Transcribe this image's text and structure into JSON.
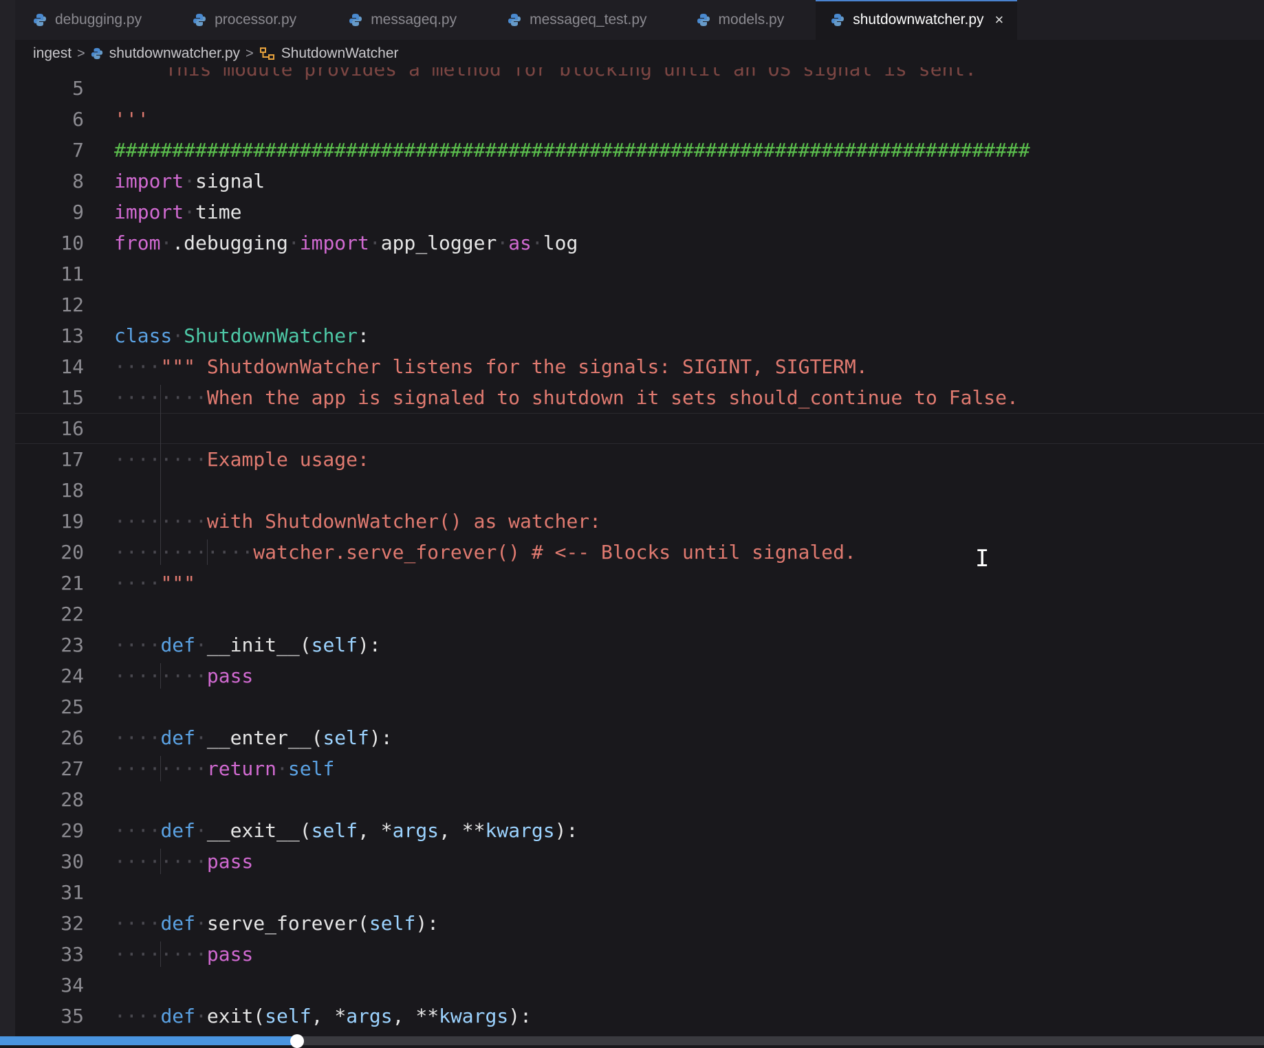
{
  "tabs": [
    {
      "label": "debugging.py",
      "active": false,
      "icon": "python-file-icon"
    },
    {
      "label": "processor.py",
      "active": false,
      "icon": "python-file-icon"
    },
    {
      "label": "messageq.py",
      "active": false,
      "icon": "python-file-icon"
    },
    {
      "label": "messageq_test.py",
      "active": false,
      "icon": "python-file-icon"
    },
    {
      "label": "models.py",
      "active": false,
      "icon": "python-file-icon"
    },
    {
      "label": "shutdownwatcher.py",
      "active": true,
      "icon": "python-file-icon"
    }
  ],
  "close_glyph": "×",
  "breadcrumb": {
    "folder": "ingest",
    "file": "shutdownwatcher.py",
    "symbol": "ShutdownWatcher",
    "separator": ">"
  },
  "editor": {
    "ghost_line": "This module provides a method for blocking until an OS signal is sent.",
    "lines": [
      {
        "n": "5",
        "tokens": []
      },
      {
        "n": "6",
        "tokens": [
          {
            "t": "str",
            "v": "'''"
          }
        ]
      },
      {
        "n": "7",
        "tokens": [
          {
            "t": "cmt",
            "v": "###############################################################################"
          }
        ]
      },
      {
        "n": "8",
        "tokens": [
          {
            "t": "kw",
            "v": "import"
          },
          {
            "t": "ws",
            "v": "·"
          },
          {
            "t": "plain",
            "v": "signal"
          }
        ]
      },
      {
        "n": "9",
        "tokens": [
          {
            "t": "kw",
            "v": "import"
          },
          {
            "t": "ws",
            "v": "·"
          },
          {
            "t": "plain",
            "v": "time"
          }
        ]
      },
      {
        "n": "10",
        "tokens": [
          {
            "t": "kw",
            "v": "from"
          },
          {
            "t": "ws",
            "v": "·"
          },
          {
            "t": "plain",
            "v": ".debugging"
          },
          {
            "t": "ws",
            "v": "·"
          },
          {
            "t": "kw",
            "v": "import"
          },
          {
            "t": "ws",
            "v": "·"
          },
          {
            "t": "plain",
            "v": "app_logger"
          },
          {
            "t": "ws",
            "v": "·"
          },
          {
            "t": "kw",
            "v": "as"
          },
          {
            "t": "ws",
            "v": "·"
          },
          {
            "t": "plain",
            "v": "log"
          }
        ]
      },
      {
        "n": "11",
        "tokens": []
      },
      {
        "n": "12",
        "tokens": []
      },
      {
        "n": "13",
        "tokens": [
          {
            "t": "kwb",
            "v": "class"
          },
          {
            "t": "ws",
            "v": "·"
          },
          {
            "t": "cls",
            "v": "ShutdownWatcher"
          },
          {
            "t": "plain",
            "v": ":"
          }
        ]
      },
      {
        "n": "14",
        "tokens": [
          {
            "t": "ws",
            "v": "····"
          },
          {
            "t": "str",
            "v": "\"\"\" ShutdownWatcher listens for the signals: SIGINT, SIGTERM."
          }
        ]
      },
      {
        "n": "15",
        "tokens": [
          {
            "t": "ws",
            "v": "········"
          },
          {
            "t": "str",
            "v": "When the app is signaled to shutdown it sets should_continue to False."
          }
        ]
      },
      {
        "n": "16",
        "tokens": [],
        "current": true
      },
      {
        "n": "17",
        "tokens": [
          {
            "t": "ws",
            "v": "········"
          },
          {
            "t": "str",
            "v": "Example usage:"
          }
        ]
      },
      {
        "n": "18",
        "tokens": []
      },
      {
        "n": "19",
        "tokens": [
          {
            "t": "ws",
            "v": "········"
          },
          {
            "t": "str",
            "v": "with ShutdownWatcher() as watcher:"
          }
        ]
      },
      {
        "n": "20",
        "tokens": [
          {
            "t": "ws",
            "v": "············"
          },
          {
            "t": "str",
            "v": "watcher.serve_forever() # <-- Blocks until signaled."
          }
        ]
      },
      {
        "n": "21",
        "tokens": [
          {
            "t": "ws",
            "v": "····"
          },
          {
            "t": "str",
            "v": "\"\"\""
          }
        ]
      },
      {
        "n": "22",
        "tokens": []
      },
      {
        "n": "23",
        "tokens": [
          {
            "t": "ws",
            "v": "····"
          },
          {
            "t": "kwb",
            "v": "def"
          },
          {
            "t": "ws",
            "v": "·"
          },
          {
            "t": "plain",
            "v": "__init__("
          },
          {
            "t": "param",
            "v": "self"
          },
          {
            "t": "plain",
            "v": "):"
          }
        ]
      },
      {
        "n": "24",
        "tokens": [
          {
            "t": "ws",
            "v": "········"
          },
          {
            "t": "kw",
            "v": "pass"
          }
        ]
      },
      {
        "n": "25",
        "tokens": []
      },
      {
        "n": "26",
        "tokens": [
          {
            "t": "ws",
            "v": "····"
          },
          {
            "t": "kwb",
            "v": "def"
          },
          {
            "t": "ws",
            "v": "·"
          },
          {
            "t": "plain",
            "v": "__enter__("
          },
          {
            "t": "param",
            "v": "self"
          },
          {
            "t": "plain",
            "v": "):"
          }
        ]
      },
      {
        "n": "27",
        "tokens": [
          {
            "t": "ws",
            "v": "········"
          },
          {
            "t": "kw",
            "v": "return"
          },
          {
            "t": "ws",
            "v": "·"
          },
          {
            "t": "kwb",
            "v": "self"
          }
        ]
      },
      {
        "n": "28",
        "tokens": []
      },
      {
        "n": "29",
        "tokens": [
          {
            "t": "ws",
            "v": "····"
          },
          {
            "t": "kwb",
            "v": "def"
          },
          {
            "t": "ws",
            "v": "·"
          },
          {
            "t": "plain",
            "v": "__exit__("
          },
          {
            "t": "param",
            "v": "self"
          },
          {
            "t": "plain",
            "v": ", *"
          },
          {
            "t": "param",
            "v": "args"
          },
          {
            "t": "plain",
            "v": ", **"
          },
          {
            "t": "param",
            "v": "kwargs"
          },
          {
            "t": "plain",
            "v": "):"
          }
        ]
      },
      {
        "n": "30",
        "tokens": [
          {
            "t": "ws",
            "v": "········"
          },
          {
            "t": "kw",
            "v": "pass"
          }
        ]
      },
      {
        "n": "31",
        "tokens": []
      },
      {
        "n": "32",
        "tokens": [
          {
            "t": "ws",
            "v": "····"
          },
          {
            "t": "kwb",
            "v": "def"
          },
          {
            "t": "ws",
            "v": "·"
          },
          {
            "t": "plain",
            "v": "serve_forever("
          },
          {
            "t": "param",
            "v": "self"
          },
          {
            "t": "plain",
            "v": "):"
          }
        ]
      },
      {
        "n": "33",
        "tokens": [
          {
            "t": "ws",
            "v": "········"
          },
          {
            "t": "kw",
            "v": "pass"
          }
        ]
      },
      {
        "n": "34",
        "tokens": []
      },
      {
        "n": "35",
        "tokens": [
          {
            "t": "ws",
            "v": "····"
          },
          {
            "t": "kwb",
            "v": "def"
          },
          {
            "t": "ws",
            "v": "·"
          },
          {
            "t": "plain",
            "v": "exit("
          },
          {
            "t": "param",
            "v": "self"
          },
          {
            "t": "plain",
            "v": ", *"
          },
          {
            "t": "param",
            "v": "args"
          },
          {
            "t": "plain",
            "v": ", **"
          },
          {
            "t": "param",
            "v": "kwargs"
          },
          {
            "t": "plain",
            "v": "):"
          }
        ]
      }
    ]
  },
  "scrollbar": {
    "position_fraction": 0.235
  },
  "colors": {
    "accent": "#4a95e0",
    "keyword": "#d16ad1",
    "keyword_blue": "#5ba2e3",
    "class_name": "#4ec9a7",
    "string": "#e07a70",
    "comment": "#5bbf4d"
  }
}
